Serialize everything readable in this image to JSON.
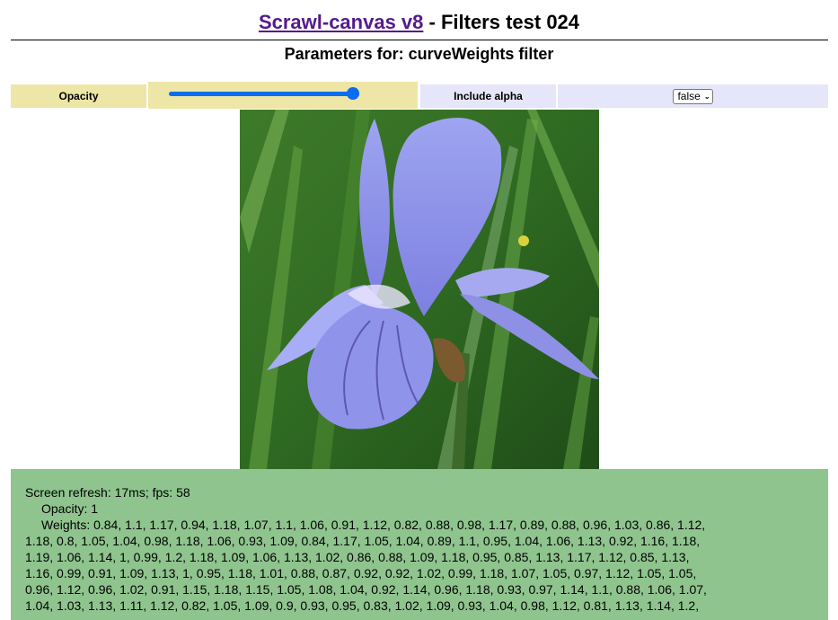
{
  "header": {
    "link_text": "Scrawl-canvas v8",
    "title_suffix": " - Filters test 024"
  },
  "subtitle": "Parameters for: curveWeights filter",
  "controls": {
    "opacity_label": "Opacity",
    "opacity_value": 1,
    "include_alpha_label": "Include alpha",
    "include_alpha_value": "false"
  },
  "canvas": {
    "icon": "iris-flower-image"
  },
  "report": {
    "refresh": "Screen refresh: 17ms; fps: 58",
    "opacity": "Opacity: 1",
    "weights_line1": "Weights: 0.84, 1.1, 1.17, 0.94, 1.18, 1.07, 1.1, 1.06, 0.91, 1.12, 0.82, 0.88, 0.98, 1.17, 0.89, 0.88, 0.96, 1.03, 0.86, 1.12,",
    "weights_line2": "1.18, 0.8, 1.05, 1.04, 0.98, 1.18, 1.06, 0.93, 1.09, 0.84, 1.17, 1.05, 1.04, 0.89, 1.1, 0.95, 1.04, 1.06, 1.13, 0.92, 1.16, 1.18,",
    "weights_line3": "1.19, 1.06, 1.14, 1, 0.99, 1.2, 1.18, 1.09, 1.06, 1.13, 1.02, 0.86, 0.88, 1.09, 1.18, 0.95, 0.85, 1.13, 1.17, 1.12, 0.85, 1.13,",
    "weights_line4": "1.16, 0.99, 0.91, 1.09, 1.13, 1, 0.95, 1.18, 1.01, 0.88, 0.87, 0.92, 0.92, 1.02, 0.99, 1.18, 1.07, 1.05, 0.97, 1.12, 1.05, 1.05,",
    "weights_line5": "0.96, 1.12, 0.96, 1.02, 0.91, 1.15, 1.18, 1.15, 1.05, 1.08, 1.04, 0.92, 1.14, 0.96, 1.18, 0.93, 0.97, 1.14, 1.1, 0.88, 1.06, 1.07,",
    "weights_line6": "1.04, 1.03, 1.13, 1.11, 1.12, 0.82, 1.05, 1.09, 0.9, 0.93, 0.95, 0.83, 1.02, 1.09, 0.93, 1.04, 0.98, 1.12, 0.81, 1.13, 1.14, 1.2,"
  }
}
